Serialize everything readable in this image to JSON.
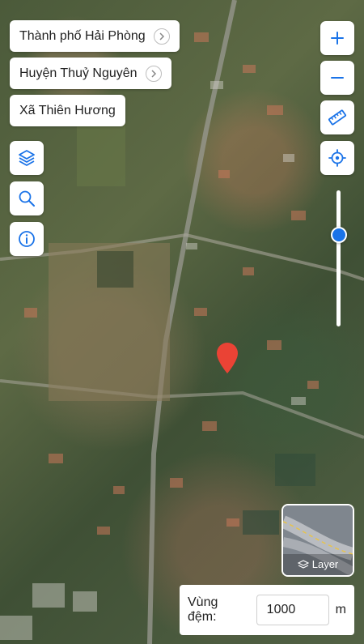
{
  "breadcrumb": {
    "city": "Thành phố Hải Phòng",
    "district": "Huyện Thuỷ Nguyên",
    "commune": "Xã Thiên Hương"
  },
  "left_tools": [
    "layers-icon",
    "search-icon",
    "info-icon"
  ],
  "right_tools": [
    "zoom-in-icon",
    "zoom-out-icon",
    "ruler-icon",
    "locate-icon"
  ],
  "opacity_slider": {
    "level": 0.33
  },
  "layer_switch": {
    "label": "Layer"
  },
  "buffer": {
    "label": "Vùng đệm:",
    "value": "1000",
    "unit": "m"
  },
  "colors": {
    "accent": "#1a73e8",
    "marker": "#ea4335"
  }
}
